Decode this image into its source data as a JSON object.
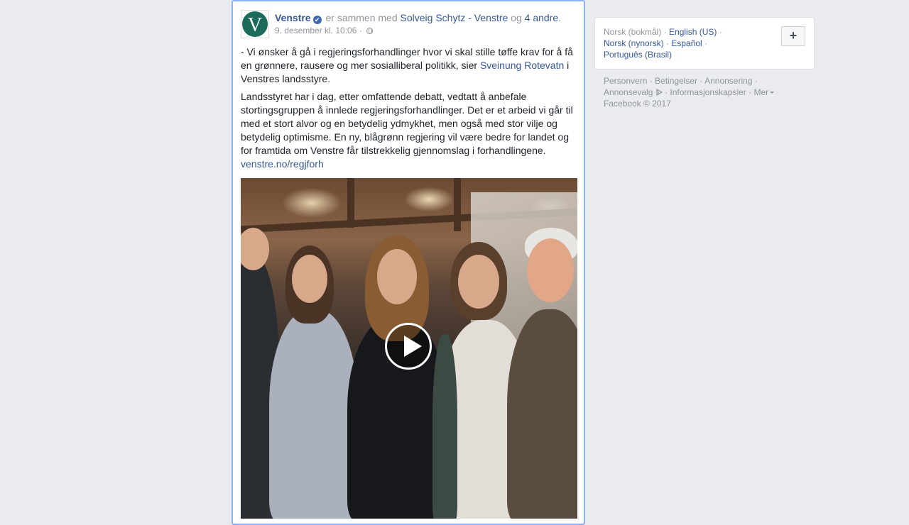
{
  "post": {
    "page_name": "Venstre",
    "with_text": "er sammen med",
    "tagged_page": "Solveig Schytz - Venstre",
    "and_text": "og",
    "others_link": "4 andre",
    "period": ".",
    "timestamp": "9. desember kl. 10:06",
    "separator": "·",
    "para1_before": "- Vi ønsker å gå i regjeringsforhandlinger hvor vi skal stille tøffe krav for å få en grønnere, rausere og mer sosialliberal politikk, sier",
    "para1_link": "Sveinung Rotevatn",
    "para1_after": "i Venstres landsstyre.",
    "para2": "Landsstyret har i dag, etter omfattende debatt, vedtatt å anbefale stortingsgruppen å innlede regjeringsforhandlinger. Det er et arbeid vi går til med et stort alvor og en betydelig ydmykhet, men også med stor vilje og betydelig optimisme. En ny, blågrønn regjering vil være bedre for landet og for framtida om Venstre får tilstrekkelig gjennomslag i forhandlingene.",
    "url_link": "venstre.no/regjforh",
    "avatar_letter": "V",
    "verified_glyph": "✔"
  },
  "languages": {
    "current": "Norsk (bokmål)",
    "options": [
      "English (US)",
      "Norsk (nynorsk)",
      "Español",
      "Português (Brasil)"
    ],
    "add_glyph": "+"
  },
  "footer": {
    "links": [
      "Personvern",
      "Betingelser",
      "Annonsering",
      "Annonsevalg",
      "Informasjonskapsler",
      "Mer"
    ],
    "copyright": "Facebook © 2017"
  },
  "colors": {
    "link": "#365899",
    "muted": "#90949c",
    "avatar_green": "#1a6b5a",
    "focus_border": "#8ab4f8"
  }
}
